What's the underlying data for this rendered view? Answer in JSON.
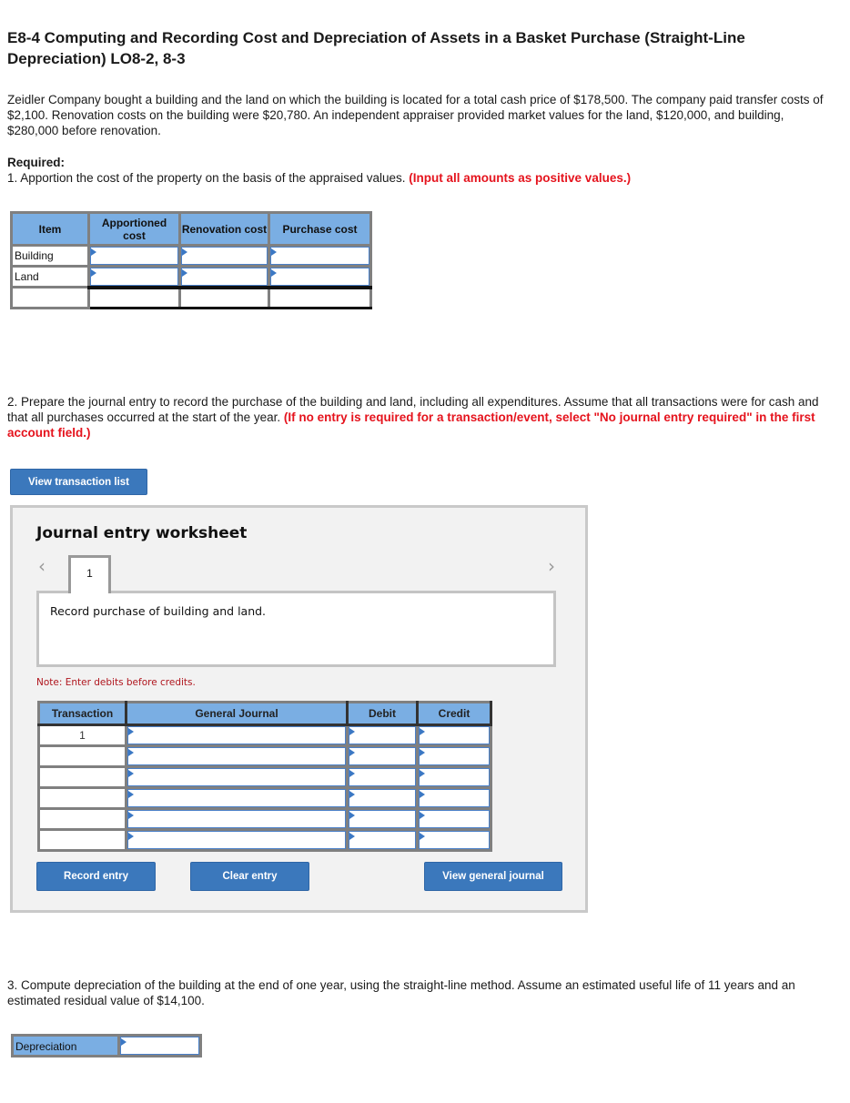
{
  "title": "E8-4 Computing and Recording Cost and Depreciation of Assets in a Basket Purchase (Straight-Line Depreciation) LO8-2, 8-3",
  "intro": "Zeidler Company bought a building and the land on which the building is located for a total cash price of $178,500. The company paid transfer costs of $2,100. Renovation costs on the building were $20,780. An independent appraiser provided market values for the land, $120,000, and building, $280,000 before renovation.",
  "required_label": "Required:",
  "part1": {
    "text": "1. Apportion the cost of the property on the basis of the appraised values. ",
    "instruction": "(Input all amounts as positive values.)",
    "table": {
      "headers": [
        "Item",
        "Apportioned cost",
        "Renovation cost",
        "Purchase cost"
      ],
      "rows": [
        {
          "item": "Building",
          "apportioned": "",
          "renovation": "",
          "purchase": ""
        },
        {
          "item": "Land",
          "apportioned": "",
          "renovation": "",
          "purchase": ""
        },
        {
          "item": "",
          "apportioned": "",
          "renovation": "",
          "purchase": ""
        }
      ]
    }
  },
  "part2": {
    "text": "2. Prepare the journal entry to record the purchase of the building and land, including all expenditures. Assume that all transactions were for cash and that all purchases occurred at the start of the year. ",
    "instruction": "(If no entry is required for a transaction/event, select \"No journal entry required\" in the first account field.)",
    "view_transaction_list": "View transaction list"
  },
  "worksheet": {
    "title": "Journal entry worksheet",
    "prev_icon": "‹",
    "next_icon": "›",
    "active_tab": "1",
    "description": "Record purchase of building and land.",
    "note": "Note: Enter debits before credits.",
    "headers": [
      "Transaction",
      "General Journal",
      "Debit",
      "Credit"
    ],
    "rows": [
      {
        "transaction": "1",
        "account": "",
        "debit": "",
        "credit": ""
      },
      {
        "transaction": "",
        "account": "",
        "debit": "",
        "credit": ""
      },
      {
        "transaction": "",
        "account": "",
        "debit": "",
        "credit": ""
      },
      {
        "transaction": "",
        "account": "",
        "debit": "",
        "credit": ""
      },
      {
        "transaction": "",
        "account": "",
        "debit": "",
        "credit": ""
      },
      {
        "transaction": "",
        "account": "",
        "debit": "",
        "credit": ""
      }
    ],
    "buttons": {
      "record": "Record entry",
      "clear": "Clear entry",
      "view_journal": "View general journal"
    }
  },
  "part3": {
    "text": "3. Compute depreciation of the building at the end of one year, using the straight-line method. Assume an estimated useful life of 11 years and an estimated residual value of $14,100.",
    "label": "Depreciation",
    "value": ""
  },
  "colors": {
    "header_blue": "#7aaee3",
    "button_blue": "#3b78bc",
    "instruction_red": "#e5131d",
    "note_red": "#b0161e",
    "worksheet_bg": "#f2f2f2"
  }
}
